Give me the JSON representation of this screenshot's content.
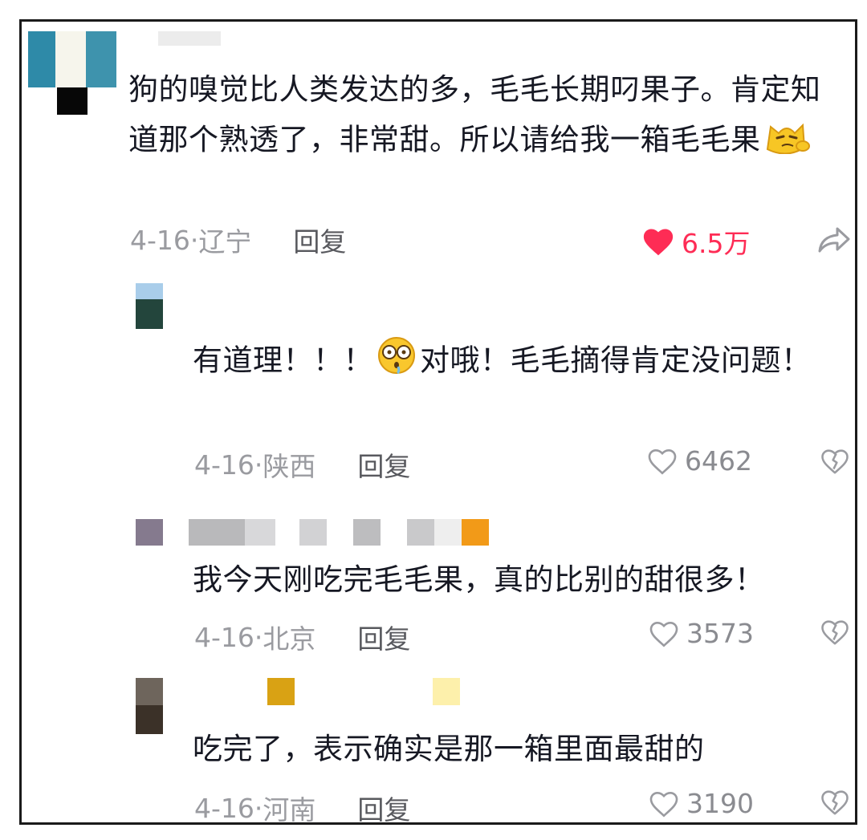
{
  "comments": [
    {
      "text": "狗的嗅觉比人类发达的多，毛毛长期叼果子。肯定知道那个熟透了，非常甜。所以请给我一箱毛毛果",
      "emoji": "smirk-cat-emoji",
      "date": "4-16",
      "location": "辽宁",
      "reply": "回复",
      "likes": "6.5万",
      "liked": true,
      "action_icon": "share-icon"
    },
    {
      "text_a": "有道理！！！",
      "emoji": "shocked-drool-emoji",
      "text_b": "对哦！毛毛摘得肯定没问题！",
      "date": "4-16",
      "location": "陕西",
      "reply": "回复",
      "likes": "6462",
      "action_icon": "dislike-heart-icon"
    },
    {
      "text": "我今天刚吃完毛毛果，真的比别的甜很多！",
      "date": "4-16",
      "location": "北京",
      "reply": "回复",
      "likes": "3573",
      "action_icon": "dislike-heart-icon"
    },
    {
      "text": "吃完了，表示确实是那一箱里面最甜的",
      "date": "4-16",
      "location": "河南",
      "reply": "回复",
      "likes": "3190",
      "action_icon": "dislike-heart-icon"
    }
  ],
  "colors": {
    "like_active": "#fe2c55",
    "meta": "#9a9ba0",
    "text": "#161823"
  }
}
